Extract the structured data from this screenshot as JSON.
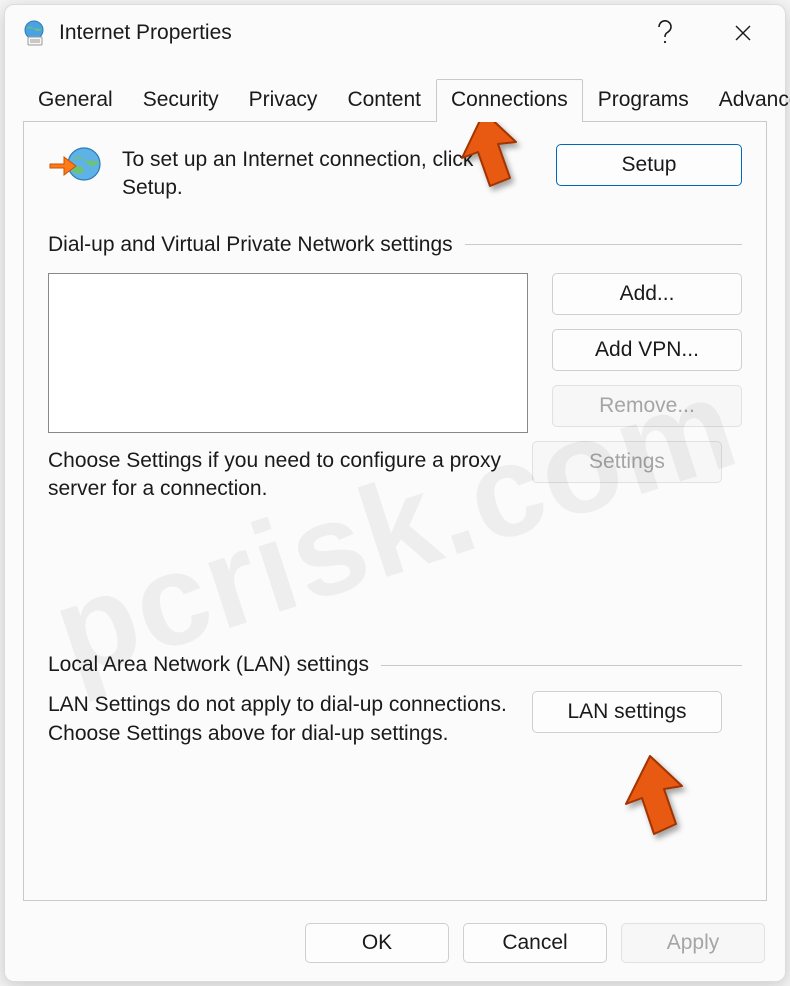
{
  "window": {
    "title": "Internet Properties"
  },
  "tabs": {
    "general": "General",
    "security": "Security",
    "privacy": "Privacy",
    "content": "Content",
    "connections": "Connections",
    "programs": "Programs",
    "advanced": "Advanced",
    "active": "connections"
  },
  "setup": {
    "text": "To set up an Internet connection, click Setup.",
    "button": "Setup"
  },
  "dialup": {
    "header": "Dial-up and Virtual Private Network settings",
    "add": "Add...",
    "add_vpn": "Add VPN...",
    "remove": "Remove...",
    "settings": "Settings",
    "note": "Choose Settings if you need to configure a proxy server for a connection."
  },
  "lan": {
    "header": "Local Area Network (LAN) settings",
    "note": "LAN Settings do not apply to dial-up connections. Choose Settings above for dial-up settings.",
    "button": "LAN settings"
  },
  "footer": {
    "ok": "OK",
    "cancel": "Cancel",
    "apply": "Apply"
  },
  "watermark": "pcrisk.com"
}
